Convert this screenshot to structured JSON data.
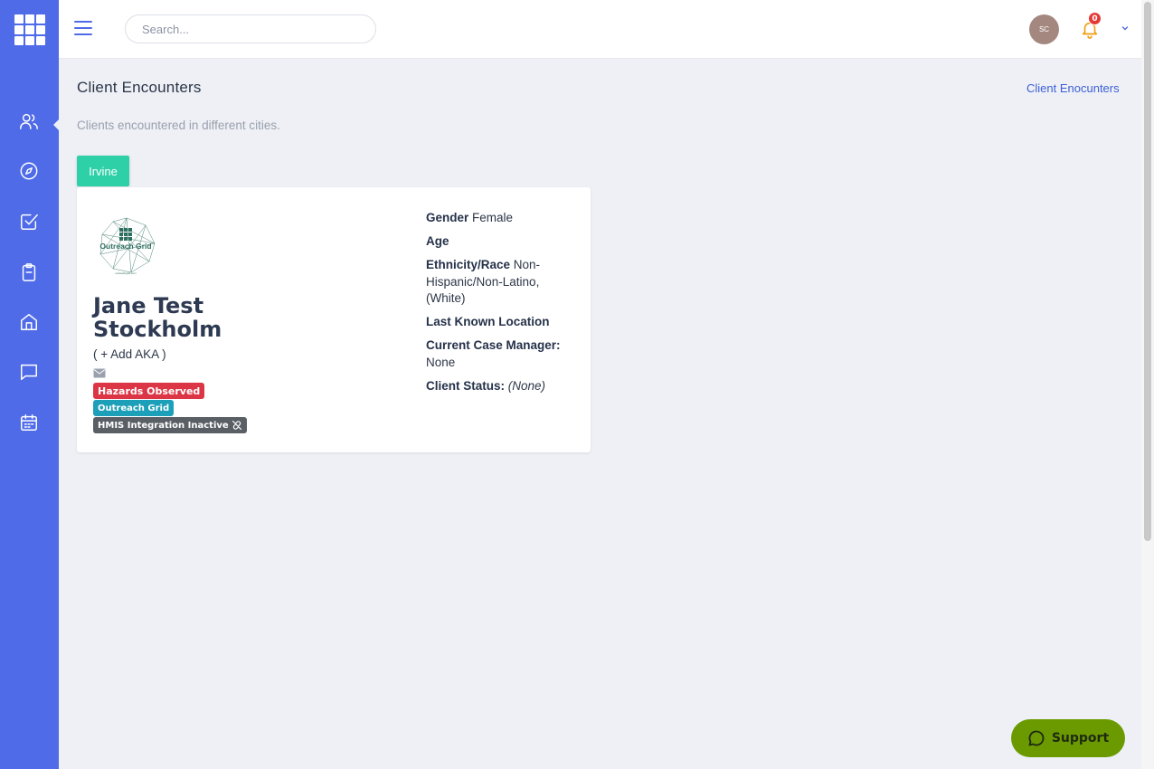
{
  "header": {
    "search_placeholder": "Search...",
    "avatar_initials": "SC",
    "notification_count": "0"
  },
  "sidebar": {
    "items": [
      {
        "icon": "users-icon"
      },
      {
        "icon": "compass-icon"
      },
      {
        "icon": "checkbox-icon"
      },
      {
        "icon": "clipboard-icon"
      },
      {
        "icon": "home-icon"
      },
      {
        "icon": "message-icon"
      },
      {
        "icon": "calendar-icon"
      }
    ]
  },
  "page": {
    "title": "Client Encounters",
    "breadcrumb": "Client Enocunters",
    "subtitle": "Clients encountered in different cities."
  },
  "city_tab": "Irvine",
  "client": {
    "logo_text": "Outreach Grid",
    "logo_url_text": "outreachgrid.com",
    "name": "Jane Test Stockholm",
    "aka_link": "( + Add AKA )",
    "tags": {
      "hazards": "Hazards Observed",
      "org": "Outreach Grid",
      "hmis": "HMIS Integration Inactive"
    },
    "info": {
      "gender_label": "Gender",
      "gender_value": "Female",
      "age_label": "Age",
      "ethnicity_label": "Ethnicity/Race",
      "ethnicity_value": "Non-Hispanic/Non-Latino, (White)",
      "location_label": "Last Known Location",
      "manager_label": "Current Case Manager:",
      "manager_value": "None",
      "status_label": "Client Status:",
      "status_value": "(None)"
    }
  },
  "support_label": "Support",
  "colors": {
    "sidebar": "#4f6be8",
    "city_tab": "#2ed0a8",
    "hazard_tag": "#dc3545",
    "org_tag": "#1c9fb8",
    "hmis_tag": "#5a5f66",
    "support": "#6b9a00",
    "bell": "#f39c12"
  }
}
